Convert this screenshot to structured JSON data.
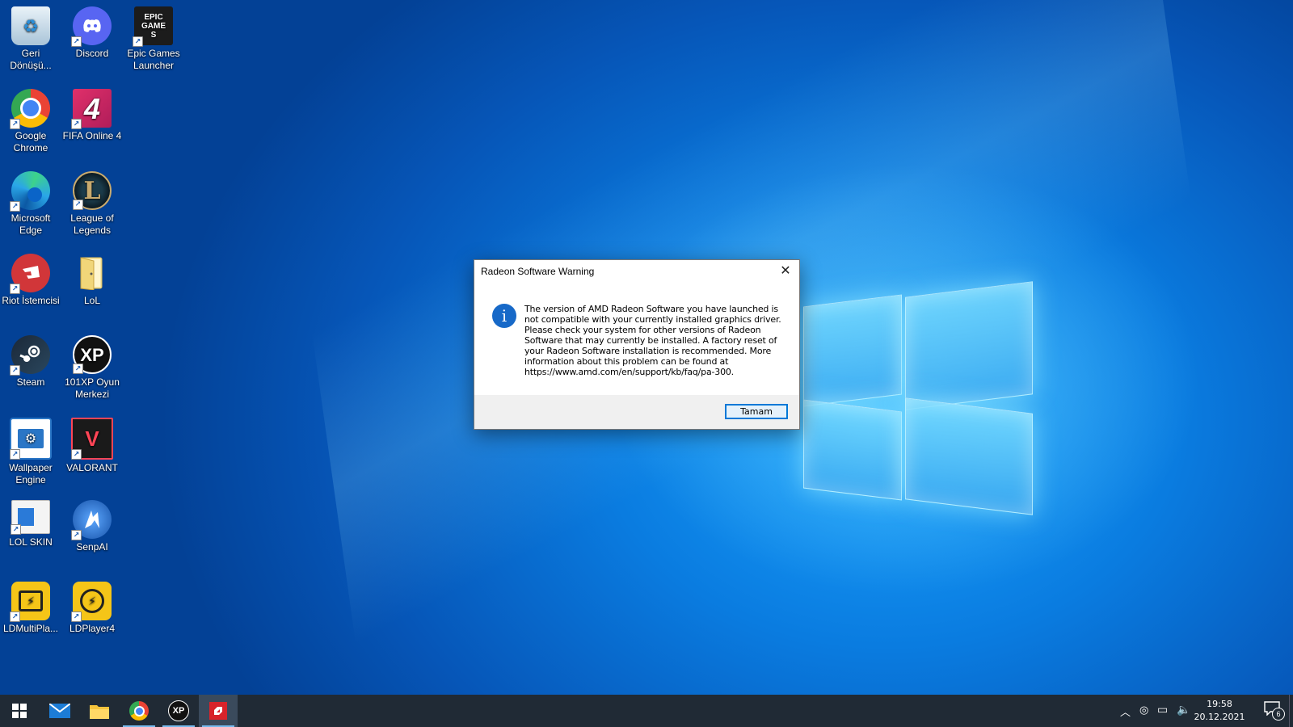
{
  "desktop": {
    "icons": [
      {
        "label": "Geri Dönüşü...",
        "name": "recycle-bin-icon"
      },
      {
        "label": "Discord",
        "name": "discord-icon"
      },
      {
        "label": "Epic Games Launcher",
        "name": "epic-games-icon",
        "logo_text": "EPIC GAMES"
      },
      {
        "label": "Google Chrome",
        "name": "chrome-icon"
      },
      {
        "label": "FIFA Online 4",
        "name": "fifa-online-icon",
        "logo_text": "4"
      },
      {
        "label": "Microsoft Edge",
        "name": "edge-icon"
      },
      {
        "label": "League of Legends",
        "name": "league-of-legends-icon",
        "logo_text": "L"
      },
      {
        "label": "Riot İstemcisi",
        "name": "riot-client-icon"
      },
      {
        "label": "LoL",
        "name": "folder-icon"
      },
      {
        "label": "Steam",
        "name": "steam-icon"
      },
      {
        "label": "101XP Oyun Merkezi",
        "name": "101xp-icon",
        "logo_text": "XP"
      },
      {
        "label": "Wallpaper Engine",
        "name": "wallpaper-engine-icon"
      },
      {
        "label": "VALORANT",
        "name": "valorant-icon",
        "logo_text": "V"
      },
      {
        "label": "LOL SKIN",
        "name": "lol-skin-icon"
      },
      {
        "label": "SenpAI",
        "name": "senpai-icon"
      },
      {
        "label": "LDMultiPla...",
        "name": "ldmultiplayer-icon"
      },
      {
        "label": "LDPlayer4",
        "name": "ldplayer-icon"
      }
    ]
  },
  "dialog": {
    "title": "Radeon Software Warning",
    "close_glyph": "✕",
    "info_glyph": "i",
    "message": "The version of AMD Radeon Software you have launched is not compatible with your currently installed graphics driver. Please check your system for other versions of Radeon Software that may currently be installed. A factory reset of your Radeon Software installation is recommended. More information about this problem can be found at https://www.amd.com/en/support/kb/faq/pa-300.",
    "ok_label": "Tamam"
  },
  "taskbar": {
    "items": [
      {
        "name": "start-button",
        "icon": "windows-icon"
      },
      {
        "name": "taskbar-mail",
        "icon": "mail-icon"
      },
      {
        "name": "taskbar-file-explorer",
        "icon": "folder-icon"
      },
      {
        "name": "taskbar-chrome",
        "icon": "chrome-icon"
      },
      {
        "name": "taskbar-101xp",
        "icon": "101xp-icon",
        "logo_text": "XP"
      },
      {
        "name": "taskbar-radeon",
        "icon": "amd-radeon-icon"
      }
    ],
    "clock": {
      "time": "19:58",
      "date": "20.12.2021"
    },
    "notification_count": "6"
  },
  "colors": {
    "accent": "#0078d7",
    "taskbar": "#202a35",
    "info_icon": "#1769c8"
  }
}
